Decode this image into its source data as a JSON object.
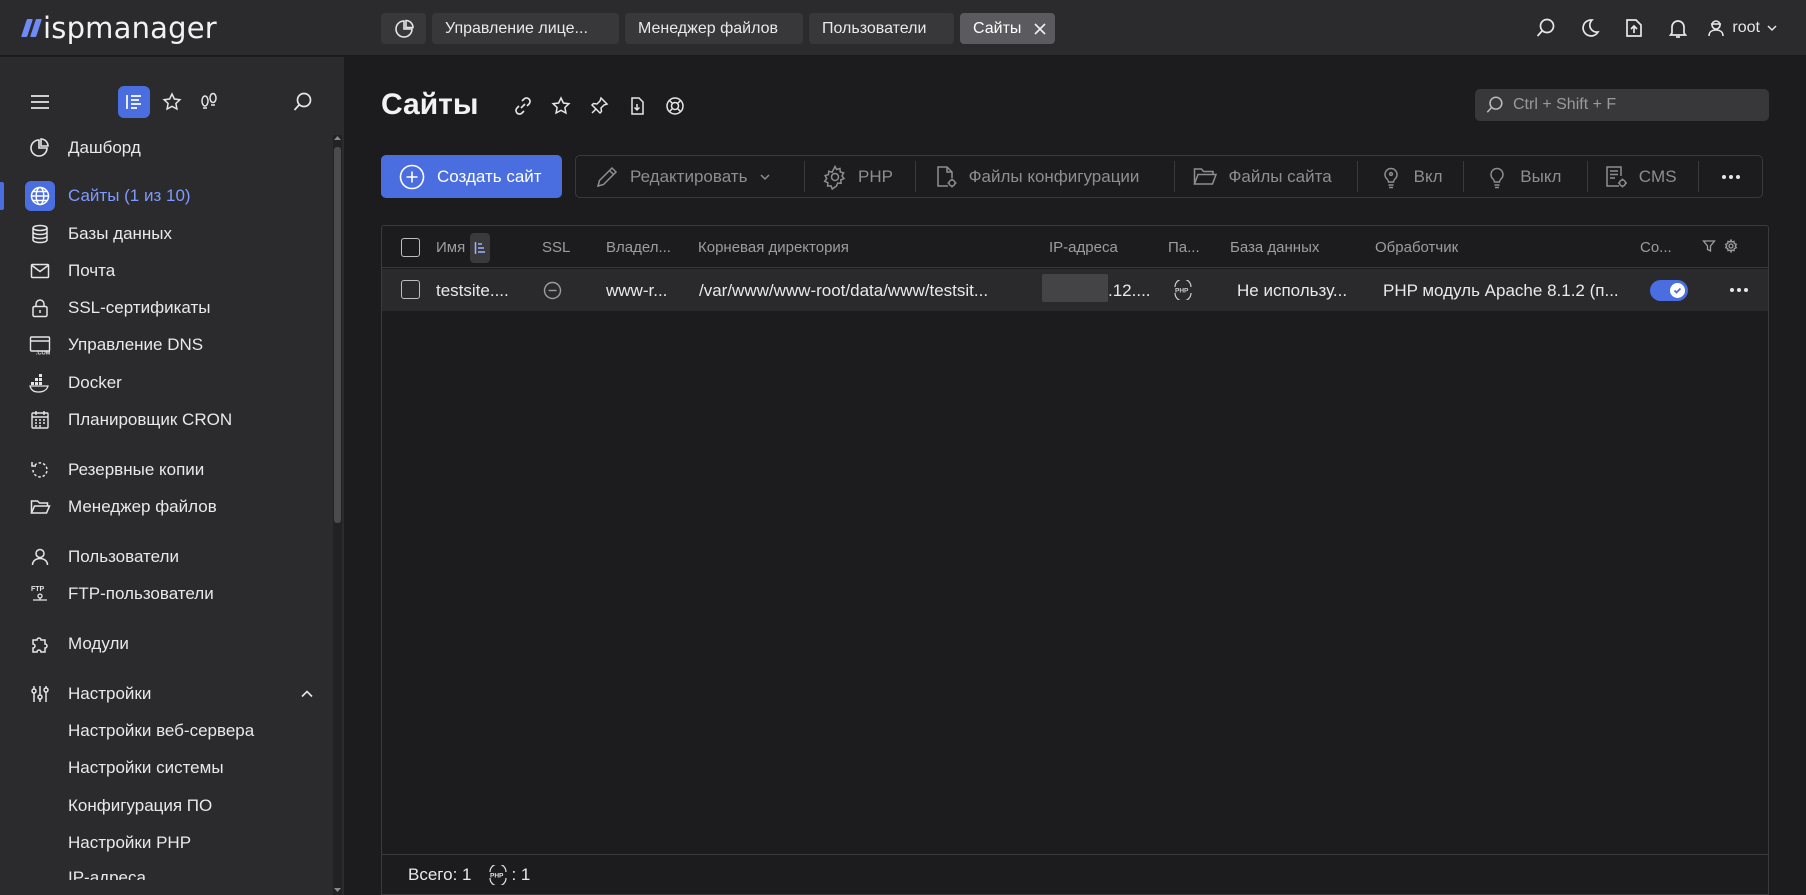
{
  "app": {
    "logo_text": "ispmanager",
    "brand_color": "#6f8cf6",
    "accent_color": "#4a6ee0"
  },
  "tabs": [
    {
      "label": "Управление лице..."
    },
    {
      "label": "Менеджер файлов"
    },
    {
      "label": "Пользователи"
    },
    {
      "label": "Сайты",
      "active": true
    }
  ],
  "header": {
    "user": "root"
  },
  "sidebar": {
    "items": [
      {
        "label": "Дашборд",
        "icon": "dashboard-icon"
      },
      {
        "label": "Сайты (1 из 10)",
        "icon": "globe-icon",
        "active": true
      },
      {
        "label": "Базы данных",
        "icon": "database-icon"
      },
      {
        "label": "Почта",
        "icon": "mail-icon"
      },
      {
        "label": "SSL-сертификаты",
        "icon": "lock-icon"
      },
      {
        "label": "Управление DNS",
        "icon": "dns-icon"
      },
      {
        "label": "Docker",
        "icon": "docker-icon"
      },
      {
        "label": "Планировщик CRON",
        "icon": "calendar-icon"
      },
      {
        "label": "Резервные копии",
        "icon": "backup-icon"
      },
      {
        "label": "Менеджер файлов",
        "icon": "folder-icon"
      },
      {
        "label": "Пользователи",
        "icon": "user-icon"
      },
      {
        "label": "FTP-пользователи",
        "icon": "ftp-icon"
      },
      {
        "label": "Модули",
        "icon": "puzzle-icon"
      },
      {
        "label": "Настройки",
        "icon": "sliders-icon"
      }
    ],
    "settings_sub": [
      {
        "label": "Настройки веб-сервера"
      },
      {
        "label": "Настройки системы"
      },
      {
        "label": "Конфигурация ПО"
      },
      {
        "label": "Настройки PHP"
      },
      {
        "label": "IP-адреса"
      }
    ]
  },
  "main": {
    "title": "Сайты",
    "search_placeholder": "Ctrl + Shift + F",
    "create_label": "Создать сайт",
    "toolbar": {
      "edit": "Редактировать",
      "php": "PHP",
      "config_files": "Файлы конфигурации",
      "site_files": "Файлы сайта",
      "on": "Вкл",
      "off": "Выкл",
      "cms": "CMS"
    },
    "table": {
      "headers": {
        "name": "Имя",
        "ssl": "SSL",
        "owner": "Владел...",
        "root": "Корневая директория",
        "ip": "IP-адреса",
        "params": "Па...",
        "db": "База данных",
        "handler": "Обработчик",
        "status": "Со..."
      },
      "rows": [
        {
          "name": "testsite....",
          "owner": "www-r...",
          "root": "/var/www/www-root/data/www/testsit...",
          "ip": ".12....",
          "db": "Не использу...",
          "handler": "PHP модуль Apache 8.1.2 (п...",
          "enabled": true
        }
      ],
      "footer": {
        "total": "Всего: 1",
        "php_count": ": 1"
      }
    }
  }
}
